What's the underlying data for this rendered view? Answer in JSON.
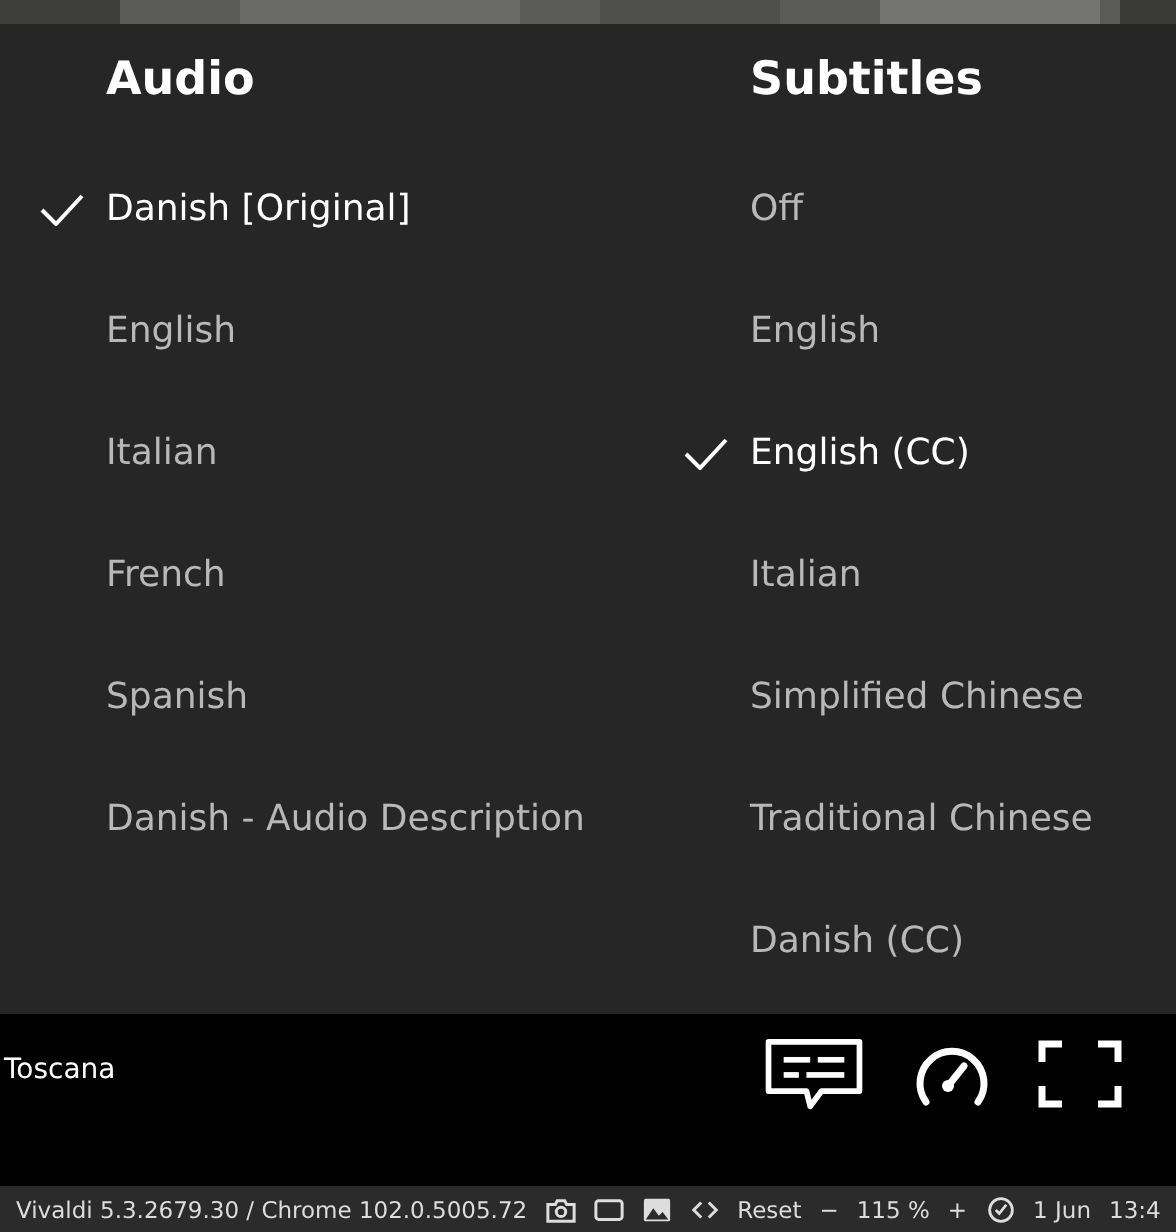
{
  "audio": {
    "heading": "Audio",
    "items": [
      {
        "label": "Danish [Original]",
        "selected": true
      },
      {
        "label": "English",
        "selected": false
      },
      {
        "label": "Italian",
        "selected": false
      },
      {
        "label": "French",
        "selected": false
      },
      {
        "label": "Spanish",
        "selected": false
      },
      {
        "label": "Danish - Audio Description",
        "selected": false
      }
    ]
  },
  "subtitles": {
    "heading": "Subtitles",
    "items": [
      {
        "label": "Off",
        "selected": false
      },
      {
        "label": "English",
        "selected": false
      },
      {
        "label": "English (CC)",
        "selected": true
      },
      {
        "label": "Italian",
        "selected": false
      },
      {
        "label": "Simplified Chinese",
        "selected": false
      },
      {
        "label": "Traditional Chinese",
        "selected": false
      },
      {
        "label": "Danish (CC)",
        "selected": false
      }
    ]
  },
  "player": {
    "title": "Toscana"
  },
  "status_bar": {
    "version": "Vivaldi 5.3.2679.30 / Chrome 102.0.5005.72",
    "reset": "Reset",
    "zoom_out": "−",
    "zoom": "115 %",
    "zoom_in": "+",
    "date": "1 Jun",
    "time": "13:4"
  }
}
